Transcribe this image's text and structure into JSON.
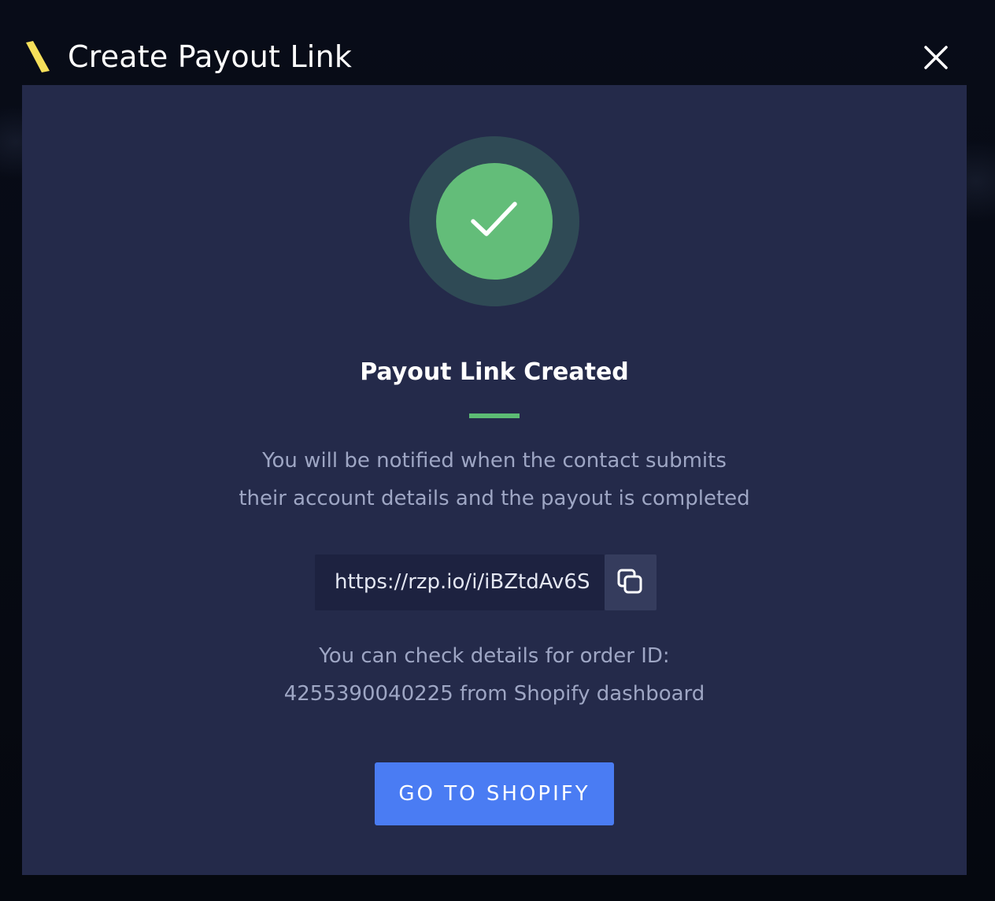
{
  "modal": {
    "title": "Create Payout Link",
    "brand_icon": "razorpay-slash-logo",
    "close_icon": "close-icon"
  },
  "success": {
    "icon": "checkmark-icon",
    "title": "Payout Link Created",
    "description_line1": "You will be notified when the contact submits",
    "description_line2": "their account details and the payout is completed"
  },
  "link": {
    "url": "https://rzp.io/i/iBZtdAv6S",
    "copy_icon": "copy-icon"
  },
  "order": {
    "line1": "You can check details for order ID:",
    "line2": "4255390040225 from Shopify dashboard"
  },
  "actions": {
    "primary_label": "GO TO SHOPIFY"
  },
  "colors": {
    "accent_green": "#63bd79",
    "primary_blue": "#4a7cf3",
    "brand_yellow": "#f5df5a",
    "panel_background": "#242a4a"
  }
}
